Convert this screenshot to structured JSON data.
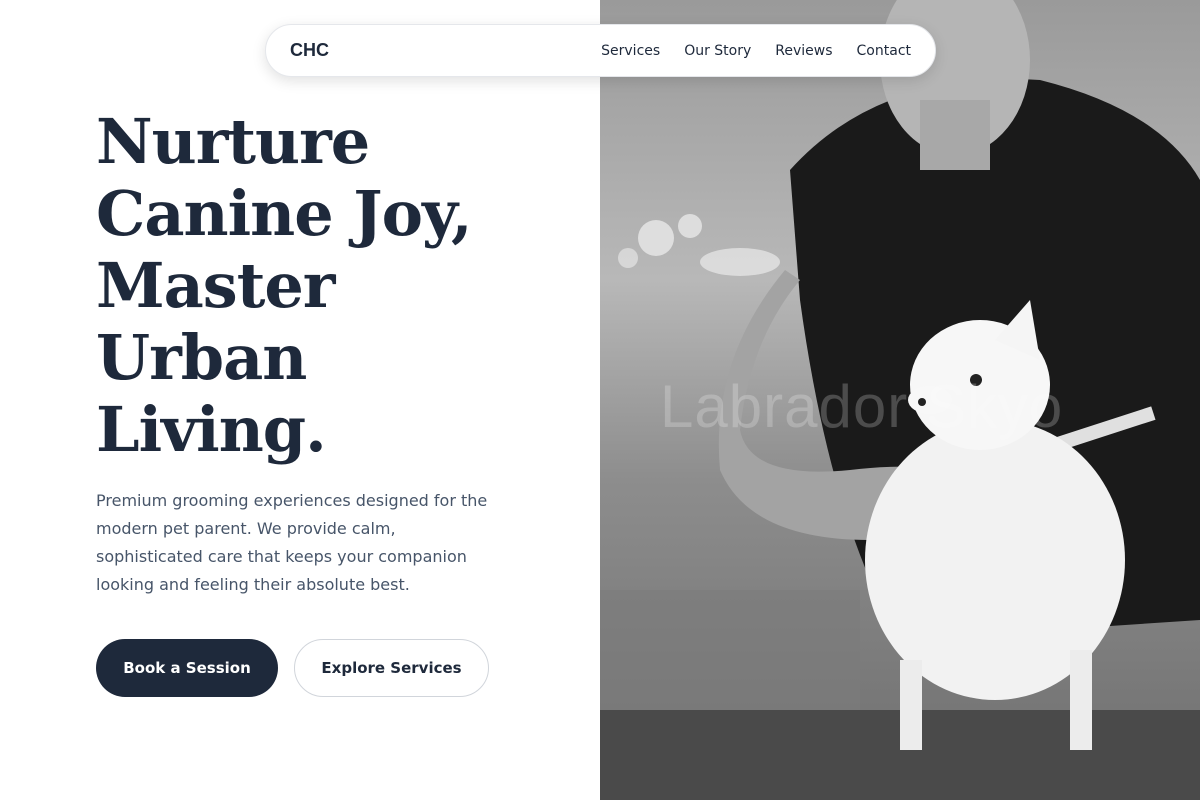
{
  "nav": {
    "brand": "CHC",
    "links": [
      "Services",
      "Our Story",
      "Reviews",
      "Contact"
    ]
  },
  "hero": {
    "headline_lines": [
      "Nurture",
      "Canine Joy,",
      "Master",
      "Urban",
      "Living."
    ],
    "subtext": "Premium grooming experiences designed for the modern pet parent. We provide calm, sophisticated care that keeps your companion looking and feeling their absolute best.",
    "primary_button": "Book a Session",
    "secondary_button": "Explore Services"
  },
  "image": {
    "subject": "groomer-combing-white-pomeranian",
    "watermark": "Labrador Skyo"
  },
  "colors": {
    "primary": "#1e293b",
    "body_text": "#475569",
    "background": "#ffffff"
  }
}
